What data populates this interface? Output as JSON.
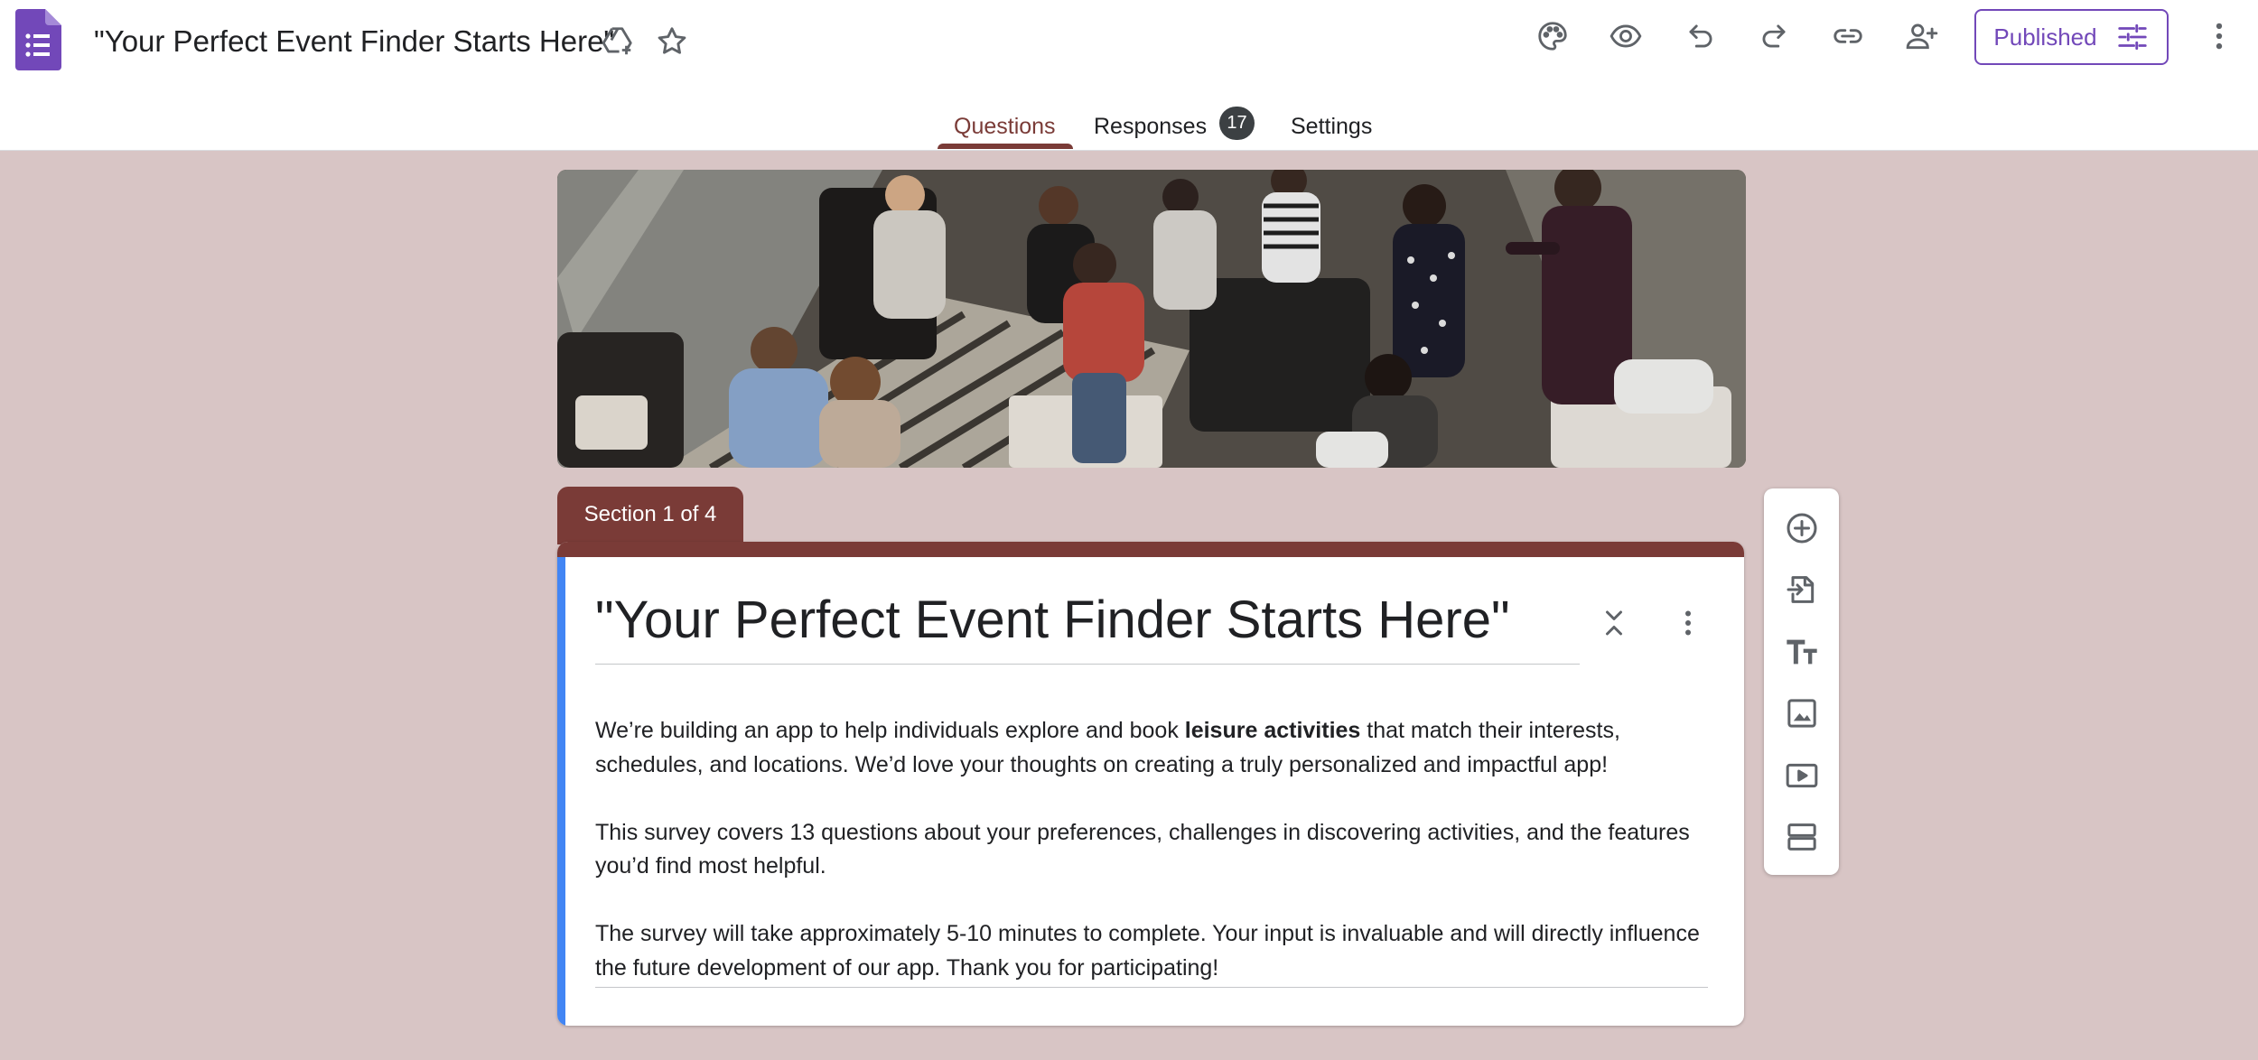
{
  "header": {
    "doc_title": "\"Your Perfect Event Finder Starts Here\"",
    "icons": [
      "forms-logo-icon",
      "add-to-drive-icon",
      "star-icon",
      "palette-icon",
      "preview-eye-icon",
      "undo-icon",
      "redo-icon",
      "link-icon",
      "add-collaborator-icon",
      "more-vert-icon"
    ],
    "publish_label": "Published",
    "publish_icon": "tune-icon"
  },
  "tabs": {
    "questions": "Questions",
    "responses": "Responses",
    "responses_count": "17",
    "settings": "Settings",
    "active": "Questions"
  },
  "banner": {
    "description": "header photo"
  },
  "section": {
    "label": "Section 1 of 4",
    "title": "\"Your Perfect Event Finder Starts Here\"",
    "desc_p1_a": "We’re building an app to help individuals explore and book ",
    "desc_p1_bold": "leisure activities",
    "desc_p1_b": " that match their interests, schedules, and locations. We’d love your thoughts on creating a truly personalized and impactful app!",
    "desc_p2": "This survey covers 13 questions about your preferences, challenges in discovering activities, and the features you’d find most helpful.",
    "desc_p3": "The survey will take approximately 5-10 minutes to complete. Your input is invaluable and will directly influence the future development of our app. Thank you for participating!"
  },
  "toolbar": {
    "items": [
      "add-question-icon",
      "import-questions-icon",
      "add-title-icon",
      "add-image-icon",
      "add-video-icon",
      "add-section-icon"
    ]
  },
  "colors": {
    "theme": "#7a3b37",
    "background": "#d8c5c5",
    "accent_blue": "#4285f4",
    "publish": "#7248b9"
  }
}
